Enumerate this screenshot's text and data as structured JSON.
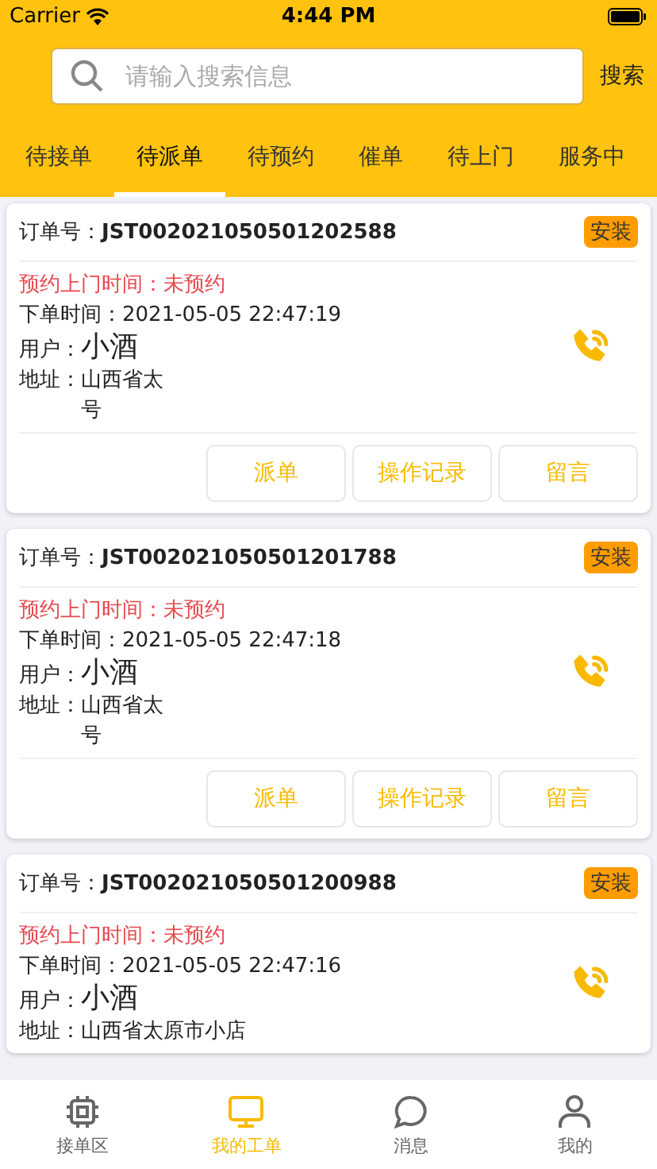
{
  "status_bar": {
    "carrier": "Carrier",
    "time": "4:44 PM"
  },
  "search": {
    "placeholder": "请输入搜索信息",
    "button": "搜索"
  },
  "tabs": [
    {
      "label": "待接单",
      "selected": false
    },
    {
      "label": "待派单",
      "selected": true
    },
    {
      "label": "待预约",
      "selected": false
    },
    {
      "label": "催单",
      "selected": false
    },
    {
      "label": "待上门",
      "selected": false
    },
    {
      "label": "服务中",
      "selected": false
    }
  ],
  "orders": [
    {
      "order_label": "订单号：",
      "order_no": "JST002021050501202588",
      "tag": "安装",
      "appointment": "预约上门时间：未预约",
      "order_time_label": "下单时间：",
      "order_time": "2021-05-05 22:47:19",
      "user_label": "用户：",
      "user": "小酒",
      "address_label": "地址：",
      "address": "山西省太",
      "address_tail": "号",
      "actions": [
        "派单",
        "操作记录",
        "留言"
      ]
    },
    {
      "order_label": "订单号：",
      "order_no": "JST002021050501201788",
      "tag": "安装",
      "appointment": "预约上门时间：未预约",
      "order_time_label": "下单时间：",
      "order_time": "2021-05-05 22:47:18",
      "user_label": "用户：",
      "user": "小酒",
      "address_label": "地址：",
      "address": "山西省太",
      "address_tail": "号",
      "actions": [
        "派单",
        "操作记录",
        "留言"
      ]
    },
    {
      "order_label": "订单号：",
      "order_no": "JST002021050501200988",
      "tag": "安装",
      "appointment": "预约上门时间：未预约",
      "order_time_label": "下单时间：",
      "order_time": "2021-05-05 22:47:16",
      "user_label": "用户：",
      "user": "小酒",
      "address_label": "地址：",
      "address": "山西省太原市小店"
    }
  ],
  "tab_bar": [
    {
      "label": "接单区",
      "kind": "chip",
      "selected": false
    },
    {
      "label": "我的工单",
      "kind": "monitor",
      "selected": true
    },
    {
      "label": "消息",
      "kind": "chat",
      "selected": false
    },
    {
      "label": "我的",
      "kind": "person",
      "selected": false
    }
  ]
}
